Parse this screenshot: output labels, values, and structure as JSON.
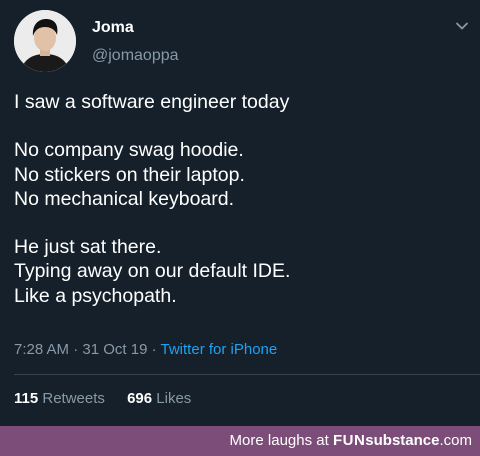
{
  "tweet": {
    "author": {
      "name": "Joma",
      "handle": "@jomaoppa"
    },
    "lines": [
      "I saw a software engineer today",
      "",
      "No company swag hoodie.",
      "No stickers on their laptop.",
      "No mechanical keyboard.",
      "",
      "He just sat there.",
      "Typing away on our default IDE.",
      "Like a psychopath."
    ],
    "time": "7:28 AM",
    "date": "31 Oct 19",
    "separator": "·",
    "source": "Twitter for iPhone",
    "stats": {
      "retweets_count": "115",
      "retweets_label": "Retweets",
      "likes_count": "696",
      "likes_label": "Likes"
    }
  },
  "footer": {
    "prefix": "More laughs at",
    "brand_part1": "FUN",
    "brand_part2": "substance",
    "brand_suffix": ".com"
  },
  "colors": {
    "background": "#15202b",
    "secondary_text": "#8899a6",
    "link": "#1da1f2",
    "footer_bg": "#7d4d79"
  },
  "icons": {
    "avatar": "profile-photo",
    "menu": "chevron-down-icon"
  }
}
